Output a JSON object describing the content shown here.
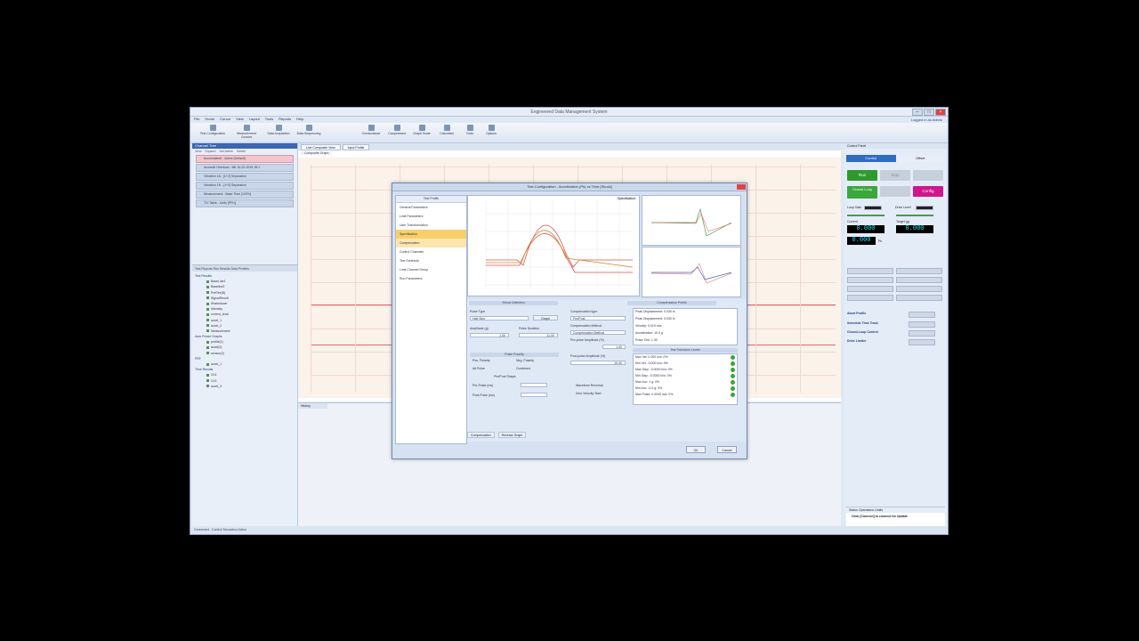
{
  "window": {
    "title": "Engineered Data Management System",
    "user_info": "Logged in as Admin"
  },
  "menu": [
    "File",
    "Home",
    "Cursor",
    "View",
    "Layout",
    "Tools",
    "Reports",
    "Help"
  ],
  "ribbon": [
    "Test Configuration",
    "Measurement Cursors",
    "Data Acquisition",
    "Data Sequencing",
    "Conductance",
    "Compressed",
    "Graph Scale",
    "Calculator",
    "Tools",
    "Options"
  ],
  "left_panel": {
    "title": "Channel Tree",
    "toolbar": [
      "View",
      "Expand",
      "Set Active",
      "Delete"
    ],
    "cursors": [
      {
        "label": "Accumulated - Active [Default]",
        "active": true
      },
      {
        "label": "Acoustic Overload - 6th 10-02-2015 18:1",
        "active": false
      },
      {
        "label": "Vibration 1A - [1+2] Separation",
        "active": false
      },
      {
        "label": "Vibration 1B - [1+2] Separation",
        "active": false
      },
      {
        "label": "Measurement - Base Time [100%]",
        "active": false
      },
      {
        "label": "T/V Table - Units [PPU]",
        "active": false
      }
    ],
    "tabs_label": "Test Reports  Run Results  Data Profiles",
    "tree": [
      {
        "type": "g",
        "label": "Test Results"
      },
      {
        "type": "c",
        "label": "BaseLine1"
      },
      {
        "type": "c",
        "label": "Baseline2"
      },
      {
        "type": "c",
        "label": "PreFire(B)"
      },
      {
        "type": "c",
        "label": "SignalResult"
      },
      {
        "type": "c",
        "label": "Shakedown"
      },
      {
        "type": "c",
        "label": "Intensity"
      },
      {
        "type": "c",
        "label": "current_level"
      },
      {
        "type": "c",
        "label": "accel_1"
      },
      {
        "type": "c",
        "label": "accel_2"
      },
      {
        "type": "c",
        "label": "Measurement"
      },
      {
        "type": "g",
        "label": "Auto Power Graphs"
      },
      {
        "type": "c",
        "label": "profile(1)"
      },
      {
        "type": "c",
        "label": "accel(2)"
      },
      {
        "type": "c",
        "label": "sensor(3)"
      },
      {
        "type": "g",
        "label": "FRF"
      },
      {
        "type": "c",
        "label": "accel_1"
      },
      {
        "type": "g",
        "label": "Time Results"
      },
      {
        "type": "c",
        "label": "Ch1"
      },
      {
        "type": "c",
        "label": "Ch2"
      },
      {
        "type": "c",
        "label": "accel_3"
      }
    ]
  },
  "center": {
    "tabs": [
      "Live Composite View",
      "Input Profile"
    ],
    "subtab": "Composite Graph"
  },
  "right_panel": {
    "header": "Control Panel",
    "tabs": [
      "Control",
      "Offset"
    ],
    "run_label": "Run",
    "stop_label": "Stop",
    "closed_loop": "Closed Loop",
    "config": "Config",
    "labels": [
      "Loop Gain",
      "Drive Level",
      "Current",
      "Target (g)"
    ],
    "readout1": "0.000",
    "readout2": "0.000",
    "readout3": "0.000",
    "unit": "Pk",
    "list": [
      "Abort Profile",
      "Schedule Time Track",
      "Closed-Loop Control",
      "Drive Limiter",
      "Event Log",
      "Alarm",
      "Display Scale"
    ],
    "bottom_tabs": "Status   Operations   Limits",
    "bottom_msg": "Click [Connect] to connect for Update"
  },
  "dialog": {
    "title": "Test Configuration - Acceleration (Pk) vs Time [Shock]",
    "nav_header": "Test Profile",
    "nav_items": [
      {
        "label": "General Parameters",
        "state": ""
      },
      {
        "label": "Limit Parameters",
        "state": ""
      },
      {
        "label": "User Transformation",
        "state": ""
      },
      {
        "label": "Specification",
        "state": "sel"
      },
      {
        "label": "Compensation",
        "state": "hov"
      },
      {
        "label": "Control Channels",
        "state": ""
      },
      {
        "label": "Test Schedule",
        "state": ""
      },
      {
        "label": "Limit Channel Group",
        "state": ""
      },
      {
        "label": "Run Parameters",
        "state": ""
      }
    ],
    "chart_label": "Specification",
    "section_left": "Shock Definition",
    "section_right": "Compensation Profile",
    "pulse_type_label": "Pulse Type",
    "pulse_type_value": "Half Sine",
    "pulse_btn": "Graph",
    "amp_label": "Amplitude (g)",
    "amp_value": "1.00",
    "dur_label": "Pulse Duration",
    "dur_value": "11.00",
    "comp_label": "Compensation type",
    "comp_value": "Pre/Post",
    "comp_label2": "Compensation Method",
    "comp_value2": "Compensation Method",
    "comp_label3": "Pre-pulse Amplitude (%)",
    "comp_value3": "1.00",
    "comp_label4": "Post-pulse Amplitude (%)",
    "comp_value4": "10.00",
    "polarity_header": "Pulse Polarity",
    "radio1": "Pos. Polarity",
    "radio2": "Neg. Polarity",
    "radio3": "Alt Pulse",
    "radio4": "Combined",
    "shape_header": "Pre/Post Shape",
    "pre_label": "Pre-Pulse (ms)",
    "post_label": "Post-Pulse (ms)",
    "opt1": "Waveform Reversal",
    "opt2": "Zero Velocity Start",
    "info_lines": [
      "Peak Displacement: 0.030 in",
      "Peak Displacement: 0.030 in",
      "Velocity: 0.019 m/s",
      "Acceleration: 10.0 g",
      "Pulse Chk: 1.00"
    ],
    "tolerance_header": "Test Tolerance Levels",
    "tolerances": [
      "Max Vel: 0.000 in/s: 0%",
      "Min Vel: -0.000 in/s: 0%",
      "Max Disp: -0.0000 in/s: 0%",
      "Min Disp: -0.0000 in/s: 0%",
      "Max Acc: 1 g: 0%",
      "Min Acc: -0.0 g: 0%",
      "Max Pulse: 0.0000 in/s: 0%"
    ],
    "footer_tabs": [
      "Compensation",
      "Reverse Graph"
    ],
    "ok": "OK",
    "cancel": "Cancel"
  },
  "status_bar": "Connected - Control Simulation Active"
}
